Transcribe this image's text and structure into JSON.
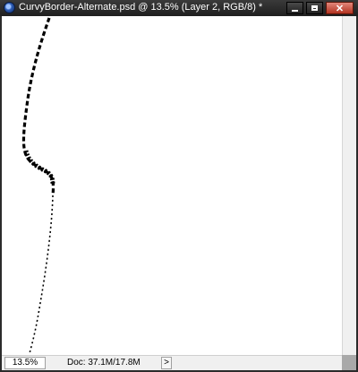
{
  "window": {
    "title": "CurvyBorder-Alternate.psd @ 13.5% (Layer 2, RGB/8) *",
    "icon": "photoshop-document-icon"
  },
  "titlebar_buttons": {
    "minimize": "minimize-icon",
    "maximize": "maximize-icon",
    "close": "✕"
  },
  "status": {
    "zoom": "13.5%",
    "doc": "Doc: 37.1M/17.8M",
    "arrow": ">"
  },
  "colors": {
    "titlebar": "#2b2b2b",
    "canvas": "#ffffff",
    "close_button": "#c94b3a"
  }
}
